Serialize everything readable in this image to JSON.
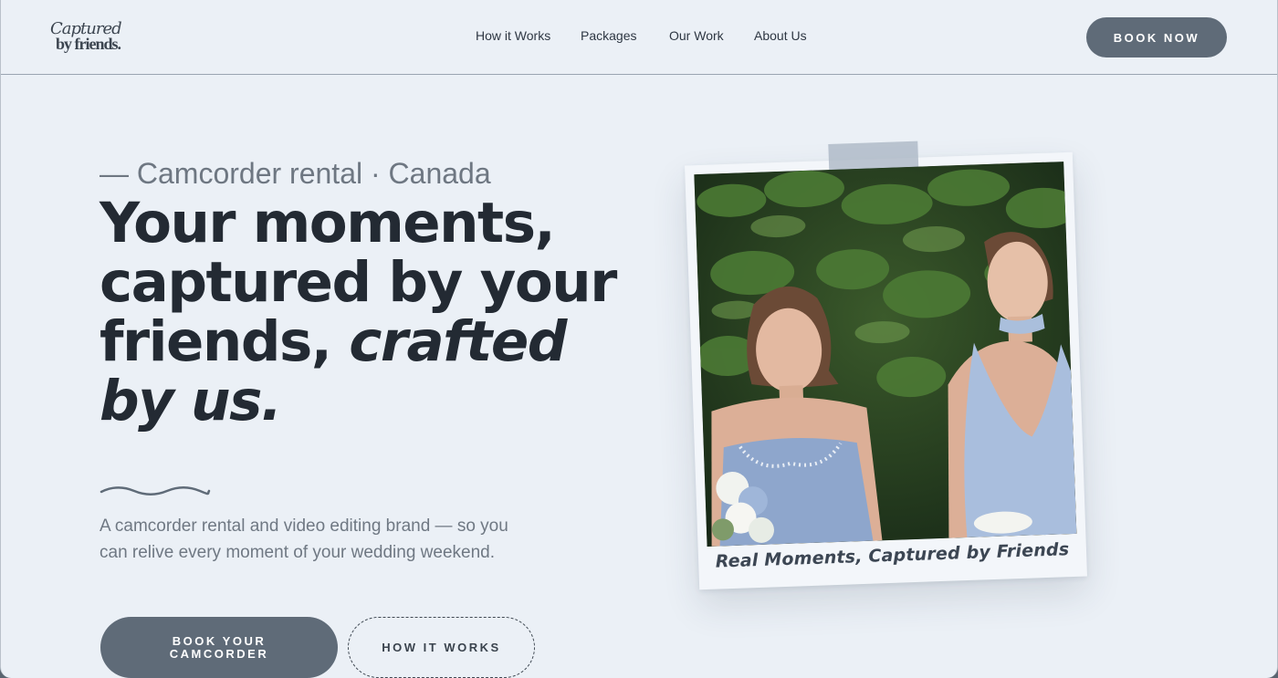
{
  "brand": {
    "logo_line1": "Captured",
    "logo_line2": "by friends."
  },
  "nav": {
    "items": [
      {
        "label": "How it Works"
      },
      {
        "label": "Packages"
      },
      {
        "label": "Our Work"
      },
      {
        "label": "About Us"
      }
    ],
    "cta_label": "BOOK NOW"
  },
  "hero": {
    "eyebrow": "— Camcorder rental · Canada",
    "headline_line1": "Your moments,",
    "headline_line2": "captured by your",
    "headline_line3_plain": "friends, ",
    "headline_line3_italic": "crafted",
    "headline_line4_italic": "by us.",
    "description": "A camcorder rental and video editing brand — so you can relive every moment of your wedding weekend.",
    "primary_cta_line1": "BOOK YOUR",
    "primary_cta_line2": "CAMCORDER",
    "secondary_cta": "HOW IT WORKS"
  },
  "polaroid": {
    "caption": "Real Moments, Captured by Friends"
  },
  "colors": {
    "background": "#ebf0f6",
    "button": "#5f6b78",
    "heading": "#232a33",
    "muted_text": "#6f7883"
  }
}
